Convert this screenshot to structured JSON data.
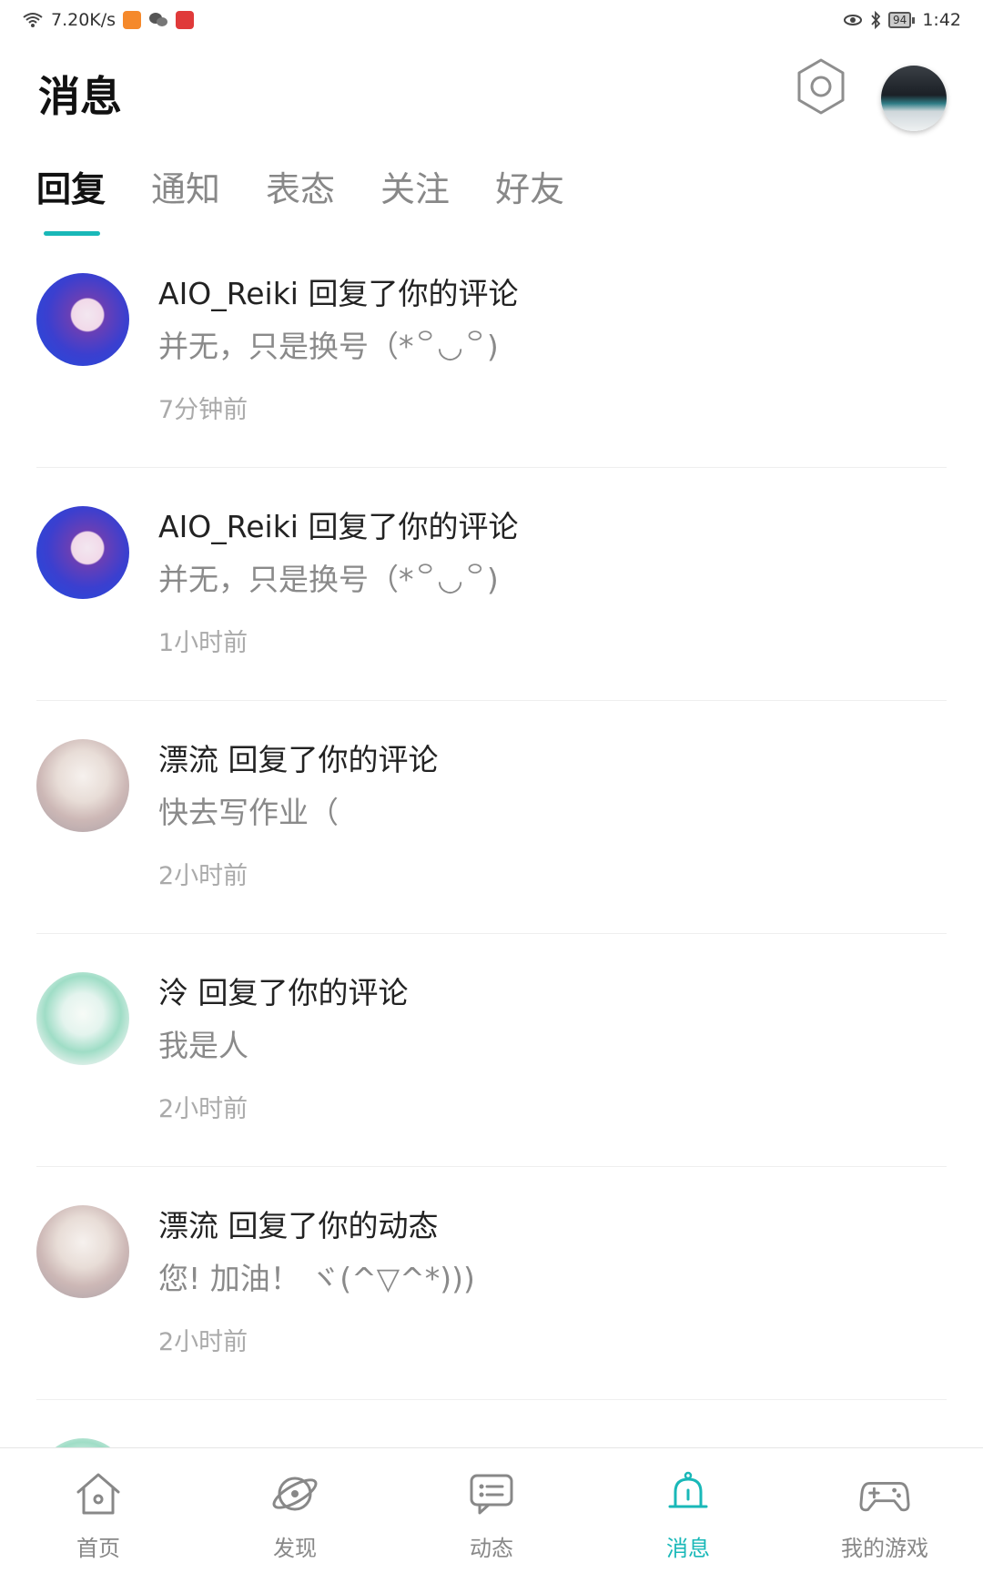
{
  "status_bar": {
    "network_speed": "7.20K/s",
    "battery": "94",
    "time": "1:42"
  },
  "header": {
    "title": "消息"
  },
  "tabs": [
    {
      "label": "回复",
      "active": true
    },
    {
      "label": "通知",
      "active": false
    },
    {
      "label": "表态",
      "active": false
    },
    {
      "label": "关注",
      "active": false
    },
    {
      "label": "好友",
      "active": false
    }
  ],
  "messages": [
    {
      "title": "AIO_Reiki 回复了你的评论",
      "content": "并无，只是换号（*꒪◡꒪)",
      "time": "7分钟前",
      "avatar": "reiki"
    },
    {
      "title": "AIO_Reiki 回复了你的评论",
      "content": "并无，只是换号（*꒪◡꒪)",
      "time": "1小时前",
      "avatar": "reiki"
    },
    {
      "title": "漂流 回复了你的评论",
      "content": "快去写作业（",
      "time": "2小时前",
      "avatar": "piaoliu"
    },
    {
      "title": "泠 回复了你的评论",
      "content": "我是人",
      "time": "2小时前",
      "avatar": "ling"
    },
    {
      "title": "漂流 回复了你的动态",
      "content": "您! 加油！ ヾ(^▽^*)))",
      "time": "2小时前",
      "avatar": "piaoliu"
    }
  ],
  "bottom_nav": [
    {
      "label": "首页",
      "icon": "home-icon",
      "active": false
    },
    {
      "label": "发现",
      "icon": "planet-icon",
      "active": false
    },
    {
      "label": "动态",
      "icon": "feed-icon",
      "active": false
    },
    {
      "label": "消息",
      "icon": "bell-icon",
      "active": true
    },
    {
      "label": "我的游戏",
      "icon": "gamepad-icon",
      "active": false
    }
  ],
  "colors": {
    "accent": "#19b8b8",
    "text_primary": "#222222",
    "text_secondary": "#8a8a8a",
    "text_muted": "#aaaaaa"
  }
}
